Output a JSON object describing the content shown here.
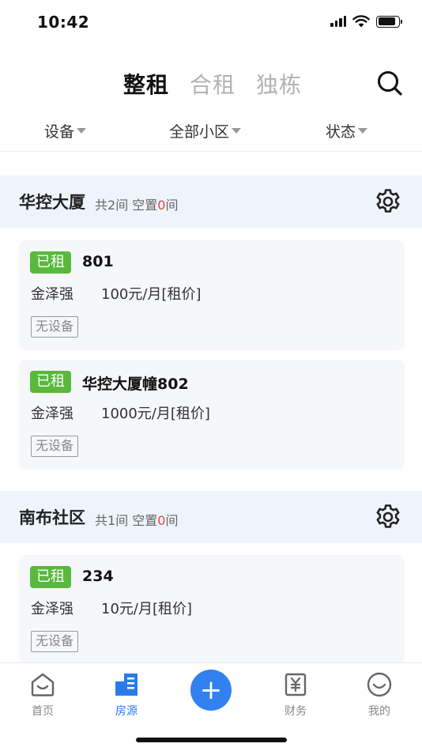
{
  "status_bar": {
    "time": "10:42"
  },
  "header": {
    "tabs": [
      {
        "label": "整租",
        "active": true
      },
      {
        "label": "合租",
        "active": false
      },
      {
        "label": "独栋",
        "active": false
      }
    ]
  },
  "filters": [
    {
      "label": "设备"
    },
    {
      "label": "全部小区"
    },
    {
      "label": "状态"
    }
  ],
  "groups": [
    {
      "name": "华控大厦",
      "total_prefix": "共",
      "total": "2",
      "total_unit": "间 空置",
      "vacant": "0",
      "vacant_unit": "间",
      "rooms": [
        {
          "status": "已租",
          "name": "801",
          "tenant": "金泽强",
          "price": "100元/月[租价]",
          "equipment": "无设备"
        },
        {
          "status": "已租",
          "name": "华控大厦幢802",
          "tenant": "金泽强",
          "price": "1000元/月[租价]",
          "equipment": "无设备"
        }
      ]
    },
    {
      "name": "南布社区",
      "total_prefix": "共",
      "total": "1",
      "total_unit": "间 空置",
      "vacant": "0",
      "vacant_unit": "间",
      "rooms": [
        {
          "status": "已租",
          "name": "234",
          "tenant": "金泽强",
          "price": "10元/月[租价]",
          "equipment": "无设备"
        }
      ]
    }
  ],
  "bottom_nav": {
    "items": [
      {
        "label": "首页",
        "icon": "home-icon",
        "active": false
      },
      {
        "label": "房源",
        "icon": "building-icon",
        "active": true
      },
      {
        "label": "财务",
        "icon": "finance-icon",
        "active": false
      },
      {
        "label": "我的",
        "icon": "profile-icon",
        "active": false
      }
    ],
    "add_label": "+"
  },
  "colors": {
    "accent": "#3380f0",
    "rented": "#58b93c",
    "vacant_count": "#e54545",
    "group_bg": "#eef4fc"
  }
}
